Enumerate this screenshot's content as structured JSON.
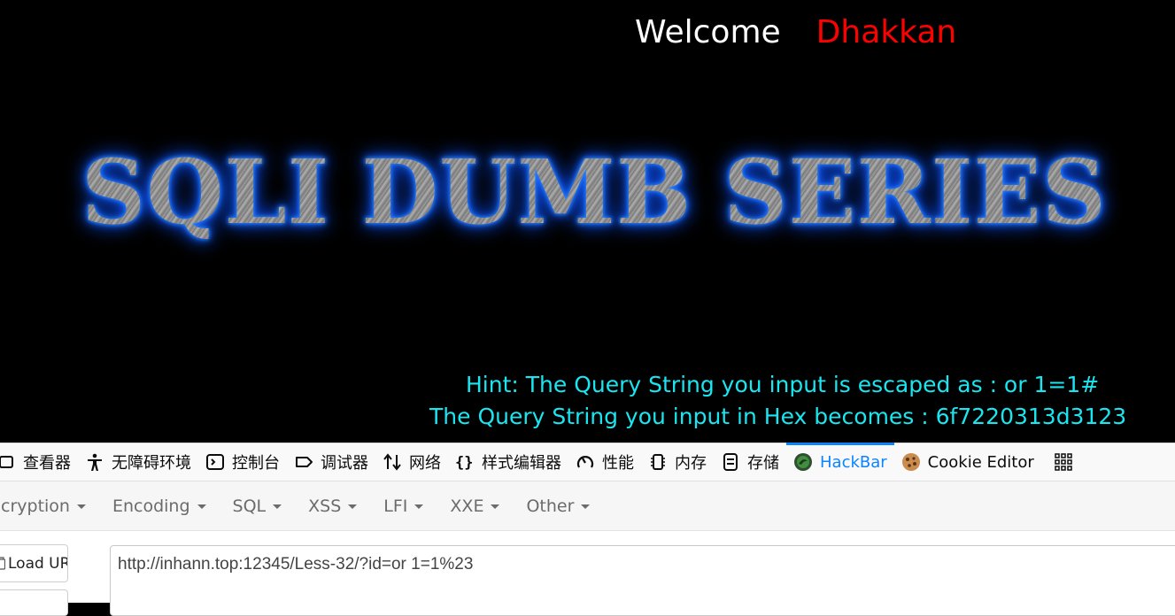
{
  "page": {
    "welcome": "Welcome",
    "username": "Dhakkan",
    "banner_title": "SQLI DUMB SERIES",
    "hint_escaped": "Hint: The Query String you input is escaped as : or 1=1#",
    "hint_hex": "The Query String you input in Hex becomes : 6f7220313d3123"
  },
  "devtools": {
    "tabs": [
      {
        "label": "查看器",
        "icon": "inspector-icon"
      },
      {
        "label": "无障碍环境",
        "icon": "accessibility-icon"
      },
      {
        "label": "控制台",
        "icon": "console-icon"
      },
      {
        "label": "调试器",
        "icon": "debugger-icon"
      },
      {
        "label": "网络",
        "icon": "network-icon"
      },
      {
        "label": "样式编辑器",
        "icon": "style-editor-icon"
      },
      {
        "label": "性能",
        "icon": "performance-icon"
      },
      {
        "label": "内存",
        "icon": "memory-icon"
      },
      {
        "label": "存储",
        "icon": "storage-icon"
      },
      {
        "label": "HackBar",
        "icon": "hackbar-icon",
        "active": true
      },
      {
        "label": "Cookie Editor",
        "icon": "cookie-icon"
      }
    ],
    "overflow_icon": "grid-menu-icon",
    "accent_color": "#0a84ff"
  },
  "hackbar": {
    "menu": [
      "cryption",
      "Encoding",
      "SQL",
      "XSS",
      "LFI",
      "XXE",
      "Other"
    ],
    "load_url_label": "Load URL",
    "url_value": "http://inhann.top:12345/Less-32/?id=or 1=1%23"
  },
  "colors": {
    "welcome": "#ffffff",
    "username": "#ff0000",
    "hint": "#19e6f0",
    "banner_glow": "#1a6cff"
  }
}
